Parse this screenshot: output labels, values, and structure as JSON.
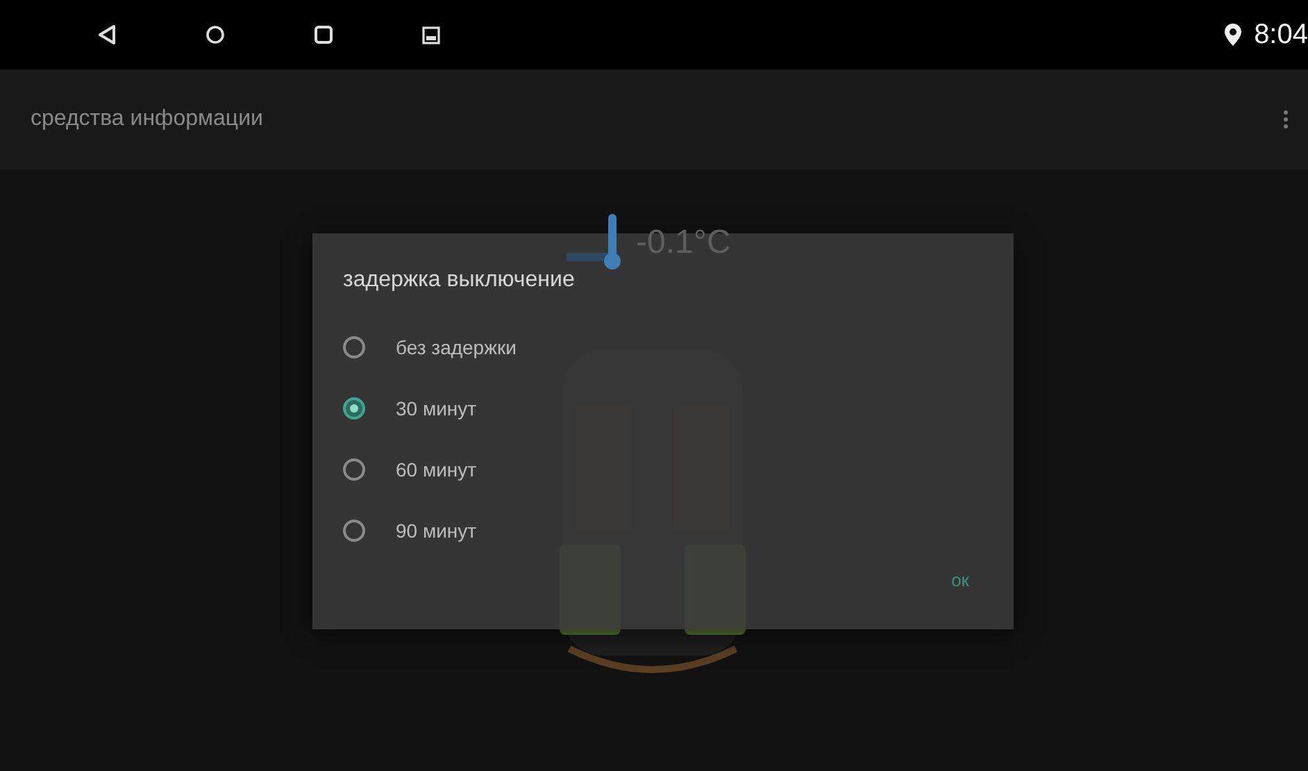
{
  "status_bar": {
    "time": "8:04"
  },
  "app_bar": {
    "title": "средства информации"
  },
  "background": {
    "temperature": "-0.1°C"
  },
  "dialog": {
    "title": "задержка выключение",
    "options": [
      {
        "label": "без задержки",
        "selected": false
      },
      {
        "label": "30 минут",
        "selected": true
      },
      {
        "label": "60 минут",
        "selected": false
      },
      {
        "label": "90 минут",
        "selected": false
      }
    ],
    "button": "ок"
  }
}
